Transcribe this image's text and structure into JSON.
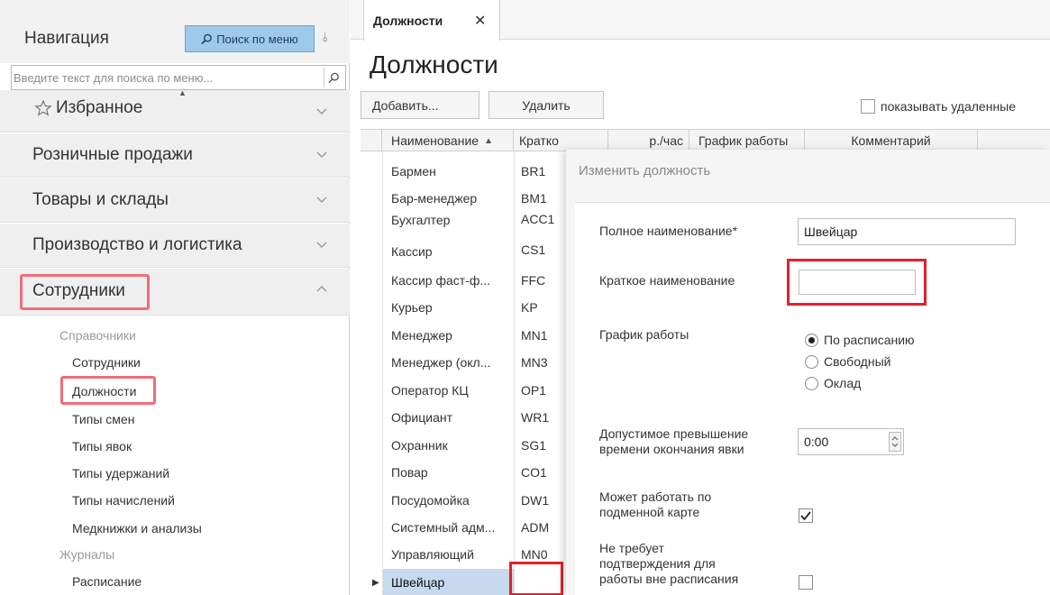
{
  "nav": {
    "title": "Навигация",
    "search_button_label": "Поиск по меню",
    "pin_glyph": "⫰",
    "search_placeholder": "Введите текст для поиска по меню...",
    "sections": [
      {
        "label": "Избранное",
        "icon": "star-icon"
      },
      {
        "label": "Розничные продажи"
      },
      {
        "label": "Товары и склады"
      },
      {
        "label": "Производство и логистика"
      },
      {
        "label": "Сотрудники"
      }
    ],
    "groups": [
      {
        "title": "Справочники",
        "items": [
          "Сотрудники",
          "Должности",
          "Типы смен",
          "Типы явок",
          "Типы удержаний",
          "Типы начислений",
          "Медкнижки и анализы"
        ]
      },
      {
        "title": "Журналы",
        "items": [
          "Расписание"
        ]
      }
    ]
  },
  "tabs": [
    {
      "label": "Должности",
      "close": "✕"
    }
  ],
  "page": {
    "title": "Должности",
    "add_button": "Добавить...",
    "delete_button": "Удалить",
    "show_deleted_label": "показывать удаленные"
  },
  "grid": {
    "columns": [
      "Наименование",
      "Кратко",
      "р./час",
      "График работы",
      "Комментарий"
    ],
    "sort_glyph": "▲",
    "selected_arrow": "▶",
    "rows": [
      {
        "name": "Бармен",
        "short": "BR1"
      },
      {
        "name": "Бар-менеджер",
        "short": "BM1"
      },
      {
        "name": "Бухгалтер",
        "short": "ACC1"
      },
      {
        "name": "Кассир",
        "short": "CS1"
      },
      {
        "name": "Кассир фаст-ф...",
        "short": "FFC"
      },
      {
        "name": "Курьер",
        "short": "KP"
      },
      {
        "name": "Менеджер",
        "short": "MN1"
      },
      {
        "name": "Менеджер (окл...",
        "short": "MN3"
      },
      {
        "name": "Оператор КЦ",
        "short": "OP1"
      },
      {
        "name": "Официант",
        "short": "WR1"
      },
      {
        "name": "Охранник",
        "short": "SG1"
      },
      {
        "name": "Повар",
        "short": "CO1"
      },
      {
        "name": "Посудомойка",
        "short": "DW1"
      },
      {
        "name": "Системный адм...",
        "short": "ADM"
      },
      {
        "name": "Управляющий",
        "short": "MN0"
      },
      {
        "name": "Швейцар",
        "short": ""
      }
    ]
  },
  "dialog": {
    "title": "Изменить должность",
    "full_name_label": "Полное наименование*",
    "full_name_value": "Швейцар",
    "short_name_label": "Краткое наименование",
    "short_name_value": "",
    "schedule_label": "График работы",
    "schedule_options": [
      "По расписанию",
      "Свободный",
      "Оклад"
    ],
    "schedule_selected": "По расписанию",
    "overtime_label_1": "Допустимое превышение",
    "overtime_label_2": "времени окончания явки",
    "overtime_value": "0:00",
    "substitute_label_1": "Может работать по",
    "substitute_label_2": "подменной карте",
    "substitute_checked": true,
    "noconfirm_label_1": "Не требует",
    "noconfirm_label_2": "подтверждения для",
    "noconfirm_label_3": "работы вне расписания",
    "noconfirm_checked": false
  },
  "colors": {
    "highlight_pink": "#f06d7a",
    "highlight_red": "#e3202e",
    "search_button_bg": "#9fc9ea",
    "selected_row": "#c7d9ee"
  }
}
